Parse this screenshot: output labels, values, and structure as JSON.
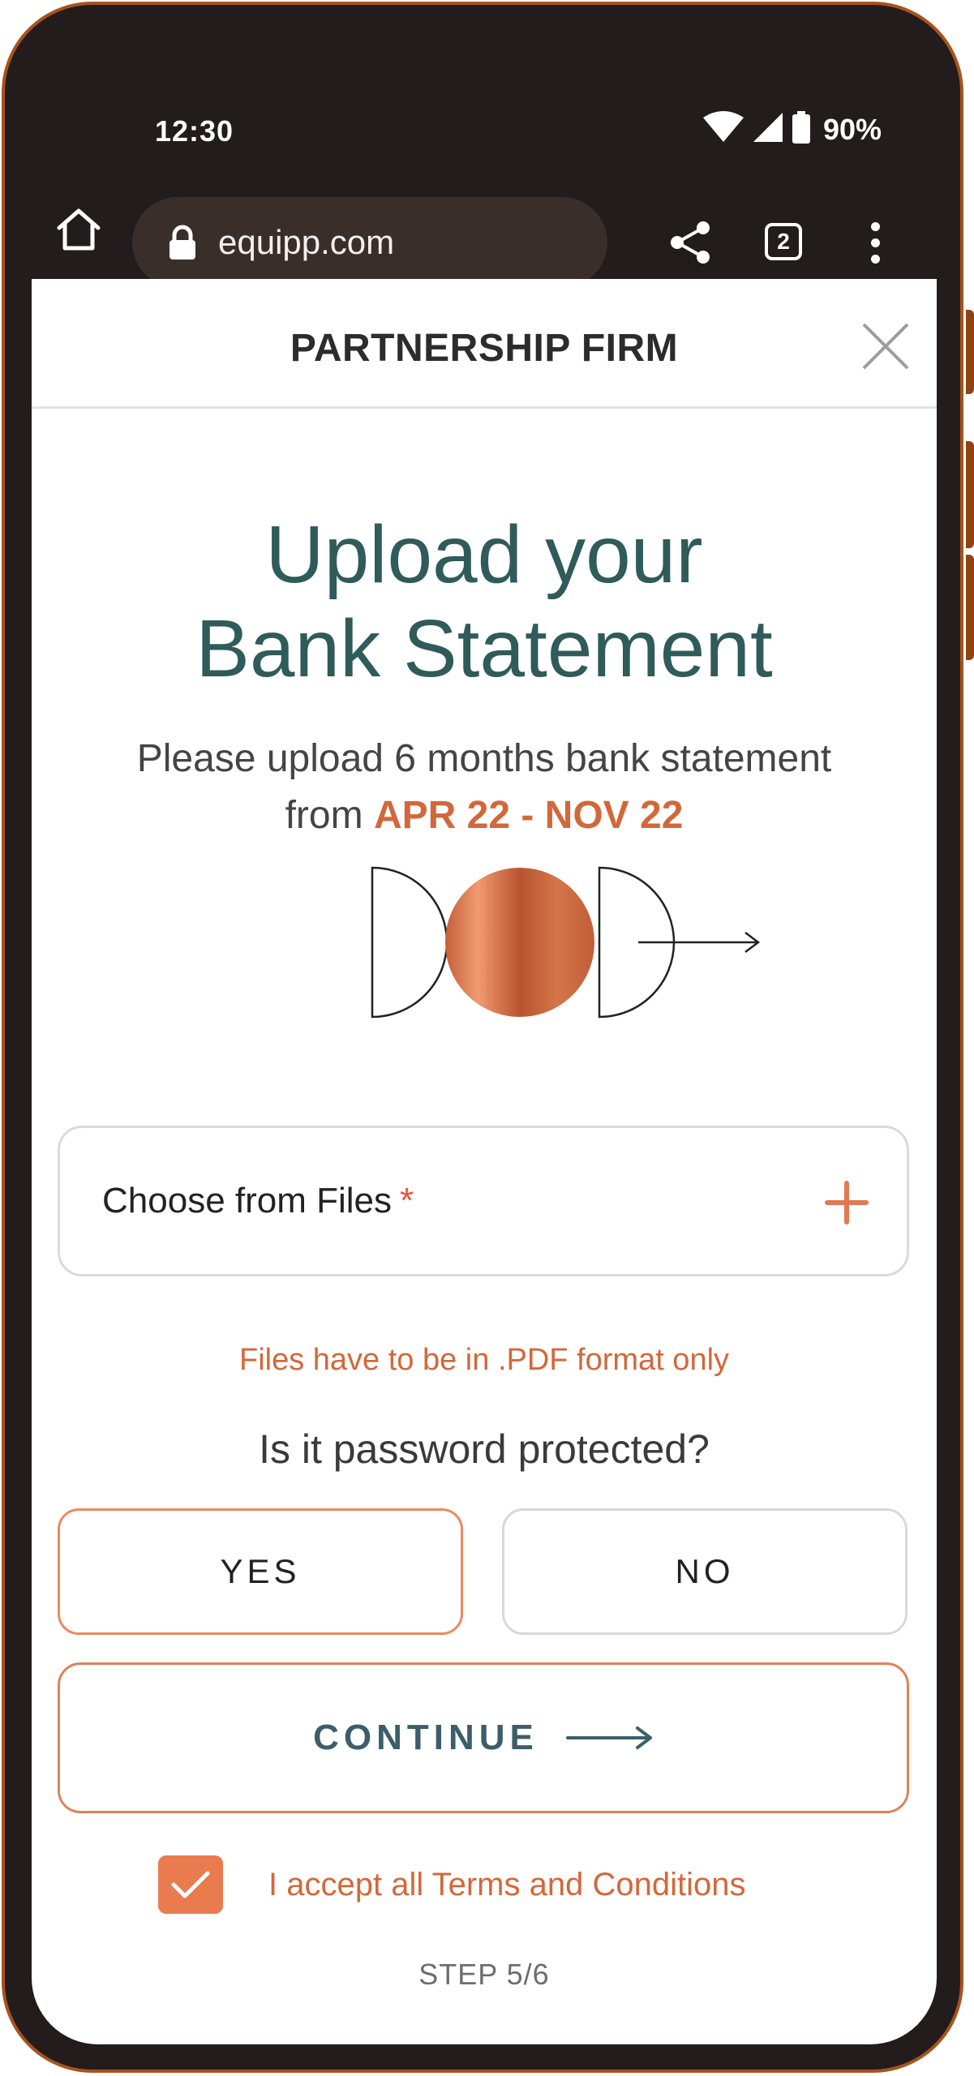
{
  "status_bar": {
    "time": "12:30",
    "battery": "90%"
  },
  "browser": {
    "url": "equipp.com",
    "tab_count": "2"
  },
  "header": {
    "title": "PARTNERSHIP FIRM"
  },
  "main": {
    "title_line1": "Upload your",
    "title_line2": "Bank Statement",
    "subtitle_line1": "Please upload 6 months bank statement",
    "subtitle_from": "from",
    "date_range": "APR 22 - NOV 22"
  },
  "file_picker": {
    "label": "Choose from Files",
    "required_mark": "*"
  },
  "format_note": "Files have to be in .PDF format only",
  "password_question": "Is it password protected?",
  "choices": {
    "yes": "YES",
    "no": "NO",
    "selected": "YES"
  },
  "continue_label": "CONTINUE",
  "terms": {
    "label": "I accept all Terms and Conditions",
    "checked": true
  },
  "step": "STEP 5/6",
  "colors": {
    "accent": "#d2683a",
    "title": "#2f5b5a",
    "frame": "#a8531c"
  }
}
